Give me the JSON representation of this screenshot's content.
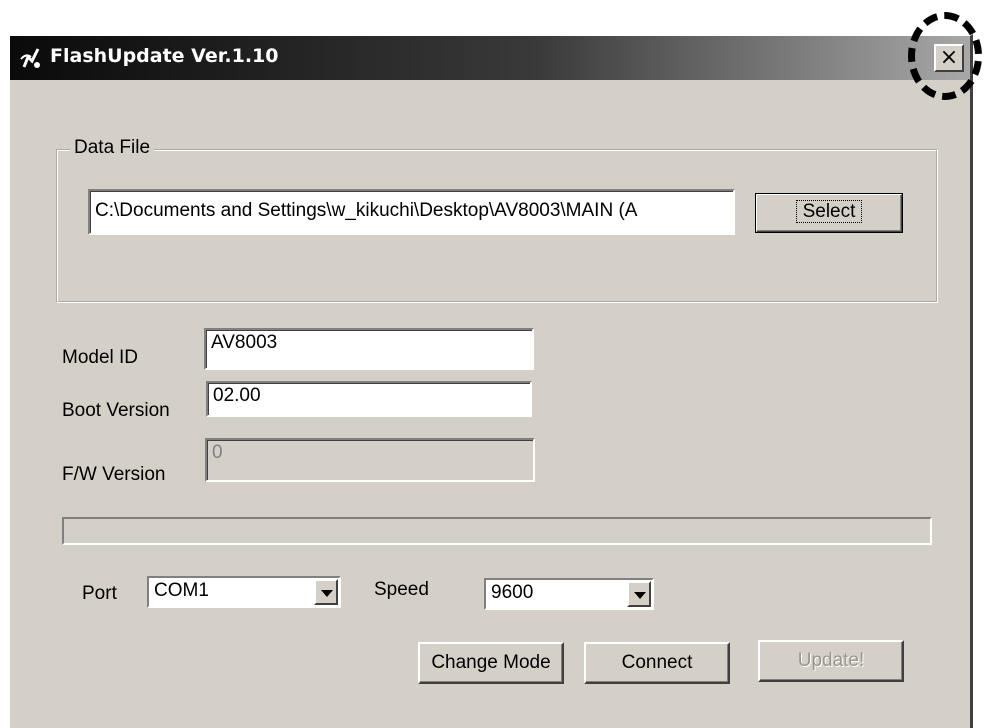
{
  "window": {
    "title": "FlashUpdate Ver.1.10",
    "close_label": "×"
  },
  "data_file": {
    "group_label": "Data File",
    "path_value": "C:\\Documents and Settings\\w_kikuchi\\Desktop\\AV8003\\MAIN (A",
    "select_label": "Select"
  },
  "fields": {
    "model_id_label": "Model ID",
    "model_id_value": "AV8003",
    "boot_version_label": "Boot Version",
    "boot_version_value": "02.00",
    "fw_version_label": "F/W Version",
    "fw_version_value": "0"
  },
  "progress": {
    "value": 0
  },
  "settings": {
    "port_label": "Port",
    "port_value": "COM1",
    "speed_label": "Speed",
    "speed_value": "9600"
  },
  "actions": {
    "change_mode_label": "Change Mode",
    "connect_label": "Connect",
    "update_label": "Update!"
  },
  "icons": {
    "app": "flash-app-icon",
    "close": "close-icon",
    "dropdown": "chevron-down-icon"
  }
}
